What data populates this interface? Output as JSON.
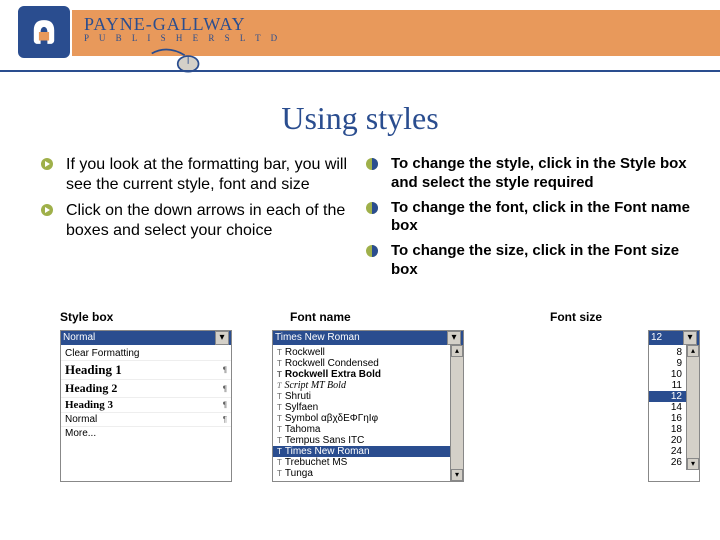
{
  "brand": {
    "name": "PAYNE-GALLWAY",
    "sub": "P U B L I S H E R S   L T D"
  },
  "title": "Using styles",
  "left_bullets": [
    "If you look at the formatting bar, you will see the current style, font and size",
    "Click on the down arrows in each of the boxes and select your choice"
  ],
  "right_bullets_1_a": "To change the style, click in the ",
  "right_bullets_1_b": "Style",
  "right_bullets_1_c": " box and select the style required",
  "right_bullets_2_a": "To change the font, click in the ",
  "right_bullets_2_b": "Font name",
  "right_bullets_2_c": " box",
  "right_bullets_3_a": "To change the size, click in the ",
  "right_bullets_3_b": "Font size",
  "right_bullets_3_c": " box",
  "labels": {
    "style": "Style box",
    "font": "Font name",
    "size": "Font size"
  },
  "style_dd": {
    "selected": "Normal",
    "items": [
      "Clear Formatting",
      "Heading 1",
      "Heading 2",
      "Heading 3",
      "Normal",
      "More..."
    ]
  },
  "font_dd": {
    "selected": "Times New Roman",
    "items": [
      "Rockwell",
      "Rockwell Condensed",
      "Rockwell Extra Bold",
      "Script MT Bold",
      "Shruti",
      "Sylfaen",
      "Symbol  αβχδΕΦΓηΙφ",
      "Tahoma",
      "Tempus Sans ITC",
      "Times New Roman",
      "Trebuchet MS",
      "Tunga"
    ]
  },
  "size_dd": {
    "selected": "12",
    "items": [
      "8",
      "9",
      "10",
      "11",
      "12",
      "14",
      "16",
      "18",
      "20",
      "24",
      "26"
    ]
  }
}
